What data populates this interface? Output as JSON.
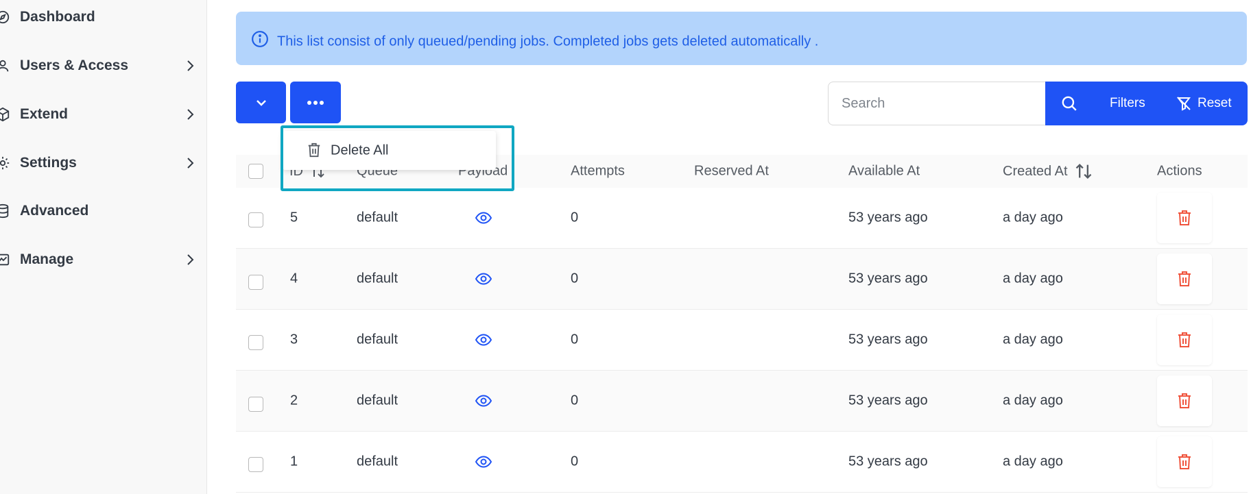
{
  "sidebar": {
    "items": [
      {
        "label": "Dashboard",
        "icon": "compass-icon",
        "has_submenu": false
      },
      {
        "label": "Users & Access",
        "icon": "user-icon",
        "has_submenu": true
      },
      {
        "label": "Extend",
        "icon": "cube-icon",
        "has_submenu": true
      },
      {
        "label": "Settings",
        "icon": "gear-icon",
        "has_submenu": true
      },
      {
        "label": "Advanced",
        "icon": "database-icon",
        "has_submenu": false
      },
      {
        "label": "Manage",
        "icon": "chart-icon",
        "has_submenu": true
      }
    ]
  },
  "alert": {
    "text": "This list consist of only queued/pending jobs. Completed jobs gets deleted automatically .",
    "icon": "info-icon"
  },
  "toolbar": {
    "search_placeholder": "Search",
    "filters_label": "Filters",
    "reset_label": "Reset"
  },
  "dropdown": {
    "items": [
      {
        "label": "Delete All",
        "icon": "trash-icon"
      }
    ]
  },
  "table": {
    "columns": [
      "ID",
      "Queue",
      "Payload",
      "Attempts",
      "Reserved At",
      "Available At",
      "Created At",
      "Actions"
    ],
    "rows": [
      {
        "id": "5",
        "queue": "default",
        "attempts": "0",
        "reserved_at": "",
        "available_at": "53 years ago",
        "created_at": "a day ago"
      },
      {
        "id": "4",
        "queue": "default",
        "attempts": "0",
        "reserved_at": "",
        "available_at": "53 years ago",
        "created_at": "a day ago"
      },
      {
        "id": "3",
        "queue": "default",
        "attempts": "0",
        "reserved_at": "",
        "available_at": "53 years ago",
        "created_at": "a day ago"
      },
      {
        "id": "2",
        "queue": "default",
        "attempts": "0",
        "reserved_at": "",
        "available_at": "53 years ago",
        "created_at": "a day ago"
      },
      {
        "id": "1",
        "queue": "default",
        "attempts": "0",
        "reserved_at": "",
        "available_at": "53 years ago",
        "created_at": "a day ago"
      }
    ]
  },
  "colors": {
    "primary": "#1f53f5",
    "alert_bg": "#b3d4fc",
    "alert_text": "#1e5ee6",
    "danger": "#f0533c",
    "highlight": "#10a7c2"
  }
}
